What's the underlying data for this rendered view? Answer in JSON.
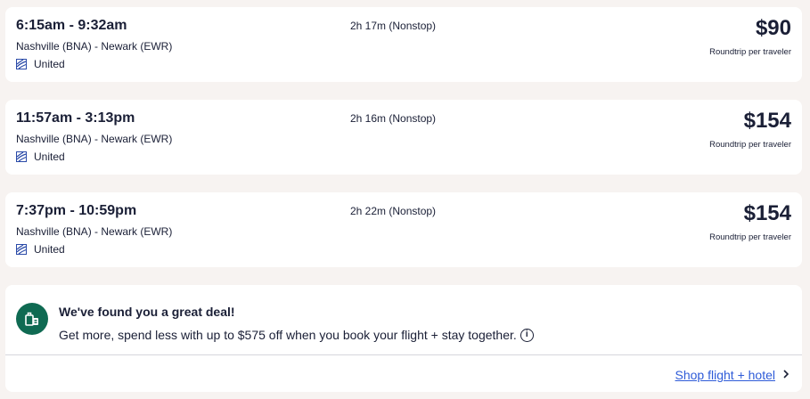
{
  "flights": [
    {
      "times": "6:15am - 9:32am",
      "route": "Nashville (BNA) - Newark (EWR)",
      "airline": "United",
      "duration": "2h 17m (Nonstop)",
      "price": "$90",
      "price_note": "Roundtrip per traveler"
    },
    {
      "times": "11:57am - 3:13pm",
      "route": "Nashville (BNA) - Newark (EWR)",
      "airline": "United",
      "duration": "2h 16m (Nonstop)",
      "price": "$154",
      "price_note": "Roundtrip per traveler"
    },
    {
      "times": "7:37pm - 10:59pm",
      "route": "Nashville (BNA) - Newark (EWR)",
      "airline": "United",
      "duration": "2h 22m (Nonstop)",
      "price": "$154",
      "price_note": "Roundtrip per traveler"
    }
  ],
  "deal": {
    "title": "We've found you a great deal!",
    "text": "Get more, spend less with up to $575 off when you book your flight + stay together.",
    "link": "Shop flight + hotel",
    "icon": "luggage-icon",
    "accent": "#0f6a52"
  },
  "colors": {
    "text": "#1a1f36",
    "link": "#2e5bd8",
    "background": "#f7f3f1"
  }
}
